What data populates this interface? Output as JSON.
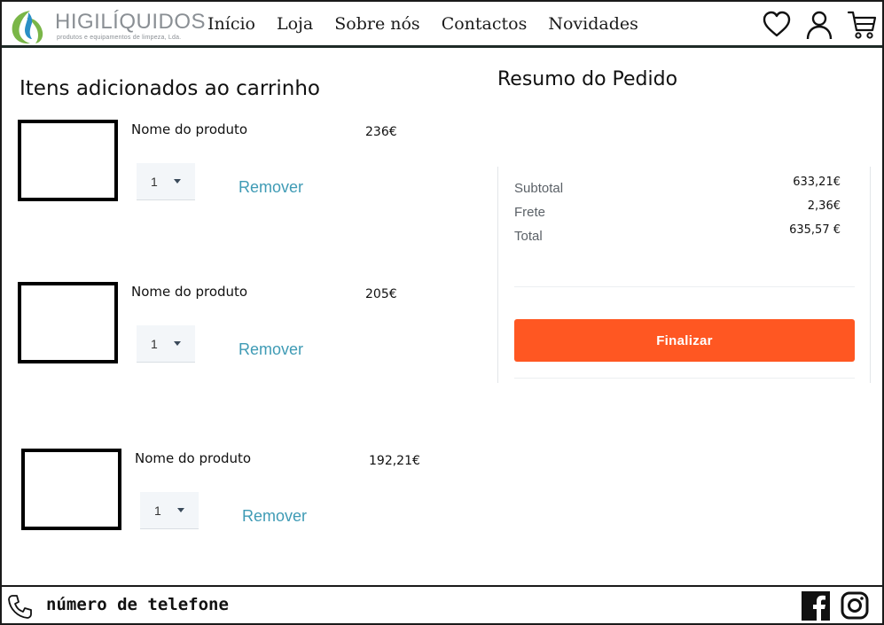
{
  "brand": {
    "name": "HIGILÍQUIDOS",
    "tagline": "produtos e equipamentos de limpeza, Lda.",
    "colors": {
      "green": "#7ab648",
      "blue": "#2a8fc6"
    }
  },
  "nav": {
    "items": [
      {
        "label": "Início"
      },
      {
        "label": "Loja"
      },
      {
        "label": "Sobre nós"
      },
      {
        "label": "Contactos"
      },
      {
        "label": "Novidades"
      }
    ]
  },
  "header_icons": [
    "heart-icon",
    "user-icon",
    "cart-icon"
  ],
  "cart": {
    "title": "Itens adicionados ao carrinho",
    "remove_label": "Remover",
    "items": [
      {
        "name": "Nome do produto",
        "price": "236€",
        "quantity": "1"
      },
      {
        "name": "Nome do produto",
        "price": "205€",
        "quantity": "1"
      },
      {
        "name": "Nome do produto",
        "price": "192,21€",
        "quantity": "1"
      }
    ]
  },
  "summary": {
    "title": "Resumo do Pedido",
    "rows": [
      {
        "label": "Subtotal",
        "value": "633,21€"
      },
      {
        "label": "Frete",
        "value": "2,36€"
      },
      {
        "label": "Total",
        "value": "635,57 €"
      }
    ],
    "button_label": "Finalizar",
    "button_color": "#ff5722"
  },
  "footer": {
    "phone_label": "número de telefone",
    "social_icons": [
      "facebook-icon",
      "instagram-icon"
    ]
  },
  "link_color": "#3f9bb5"
}
